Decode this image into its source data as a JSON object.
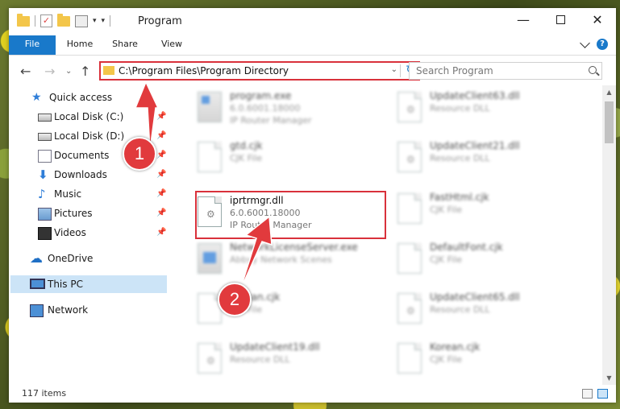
{
  "window": {
    "title": "Program",
    "controls": {
      "minimize": "—",
      "close": "✕"
    }
  },
  "ribbon": {
    "tabs": [
      {
        "label": "File"
      },
      {
        "label": "Home"
      },
      {
        "label": "Share"
      },
      {
        "label": "View"
      }
    ],
    "help": "?"
  },
  "nav": {
    "back": "←",
    "forward": "→",
    "recent": "⌄",
    "up": "↑",
    "address": "C:\\Program Files\\Program Directory",
    "search_placeholder": "Search Program"
  },
  "sidebar": {
    "items": [
      {
        "label": "Quick access",
        "icon": "star-icon"
      },
      {
        "label": "Local Disk (C:)",
        "icon": "disk-icon",
        "pinned": true
      },
      {
        "label": "Local Disk (D:)",
        "icon": "disk-icon",
        "pinned": true
      },
      {
        "label": "Documents",
        "icon": "documents-icon",
        "pinned": true
      },
      {
        "label": "Downloads",
        "icon": "downloads-icon",
        "pinned": true
      },
      {
        "label": "Music",
        "icon": "music-icon",
        "pinned": true
      },
      {
        "label": "Pictures",
        "icon": "pictures-icon",
        "pinned": true
      },
      {
        "label": "Videos",
        "icon": "videos-icon",
        "pinned": true
      },
      {
        "label": "OneDrive",
        "icon": "onedrive-icon"
      },
      {
        "label": "This PC",
        "icon": "this-pc-icon",
        "selected": true
      },
      {
        "label": "Network",
        "icon": "network-icon"
      }
    ]
  },
  "files": [
    {
      "name": "program.exe",
      "line1": "6.0.6001.18000",
      "line2": "IP Router Manager",
      "type": "exe"
    },
    {
      "name": "UpdateClient63.dll",
      "line1": "Resource DLL",
      "line2": "",
      "type": "dll"
    },
    {
      "name": "gtd.cjk",
      "line1": "CJK File",
      "line2": "",
      "type": "file"
    },
    {
      "name": "UpdateClient21.dll",
      "line1": "Resource DLL",
      "line2": "",
      "type": "dll"
    },
    {
      "name": "iprtrmgr.dll",
      "line1": "6.0.6001.18000",
      "line2": "IP Router Manager",
      "type": "dll",
      "highlighted": true
    },
    {
      "name": "FastHtml.cjk",
      "line1": "CJK File",
      "line2": "",
      "type": "file"
    },
    {
      "name": "NetworkLicenseServer.exe",
      "line1": "Abbyy Network Scenes",
      "line2": "",
      "type": "exe"
    },
    {
      "name": "DefaultFont.cjk",
      "line1": "CJK File",
      "line2": "",
      "type": "file"
    },
    {
      "name": "Korean.cjk",
      "line1": "CJK File",
      "line2": "",
      "type": "file"
    },
    {
      "name": "UpdateClient65.dll",
      "line1": "Resource DLL",
      "line2": "",
      "type": "dll"
    },
    {
      "name": "UpdateClient19.dll",
      "line1": "Resource DLL",
      "line2": "",
      "type": "dll"
    },
    {
      "name": "Korean.cjk",
      "line1": "CJK File",
      "line2": "",
      "type": "file"
    }
  ],
  "status": {
    "count": "117 items"
  },
  "annotations": {
    "step1": "1",
    "step2": "2",
    "color": "#e13a3d"
  },
  "colors": {
    "accent": "#1979ca",
    "highlight": "#d9313b",
    "selection": "#cce4f7"
  }
}
